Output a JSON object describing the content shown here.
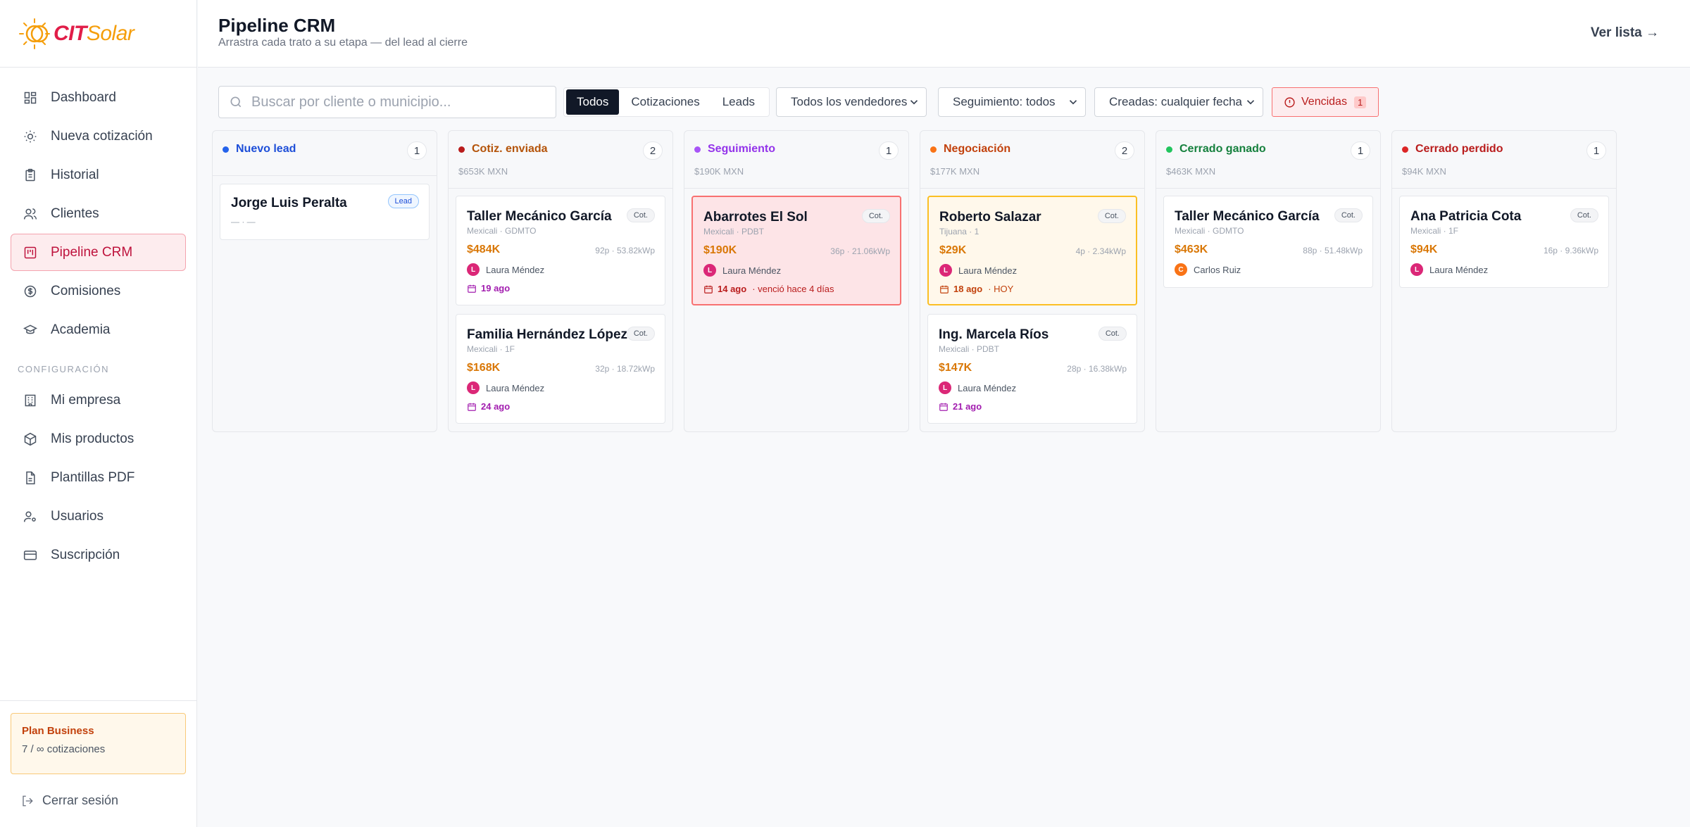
{
  "brand": {
    "cit": "CIT",
    "solar": "Solar"
  },
  "header": {
    "title": "Pipeline CRM",
    "subtitle": "Arrastra cada trato a su etapa — del lead al cierre",
    "ver_lista": "Ver lista →"
  },
  "sidebar": {
    "items": [
      {
        "label": "Dashboard",
        "icon": "dashboard-icon"
      },
      {
        "label": "Nueva cotización",
        "icon": "sun-icon"
      },
      {
        "label": "Historial",
        "icon": "clipboard-icon"
      },
      {
        "label": "Clientes",
        "icon": "users-icon"
      },
      {
        "label": "Pipeline CRM",
        "icon": "kanban-icon"
      },
      {
        "label": "Comisiones",
        "icon": "coin-icon"
      },
      {
        "label": "Academia",
        "icon": "graduation-cap-icon"
      }
    ],
    "section_label": "CONFIGURACIÓN",
    "config_items": [
      {
        "label": "Mi empresa",
        "icon": "building-icon"
      },
      {
        "label": "Mis productos",
        "icon": "box-icon"
      },
      {
        "label": "Plantillas PDF",
        "icon": "file-icon"
      },
      {
        "label": "Usuarios",
        "icon": "user-key-icon"
      },
      {
        "label": "Suscripción",
        "icon": "credit-card-icon"
      }
    ],
    "plan": {
      "title": "Plan Business",
      "usage": "7 / ∞ cotizaciones"
    },
    "logout": "Cerrar sesión"
  },
  "toolbar": {
    "search_placeholder": "Buscar por cliente o municipio...",
    "segments": [
      "Todos",
      "Cotizaciones",
      "Leads"
    ],
    "selected_segment": "Todos",
    "sellers": "Todos los vendedores",
    "followup": "Seguimiento: todos",
    "created": "Creadas: cualquier fecha",
    "overdue_label": "Vencidas",
    "overdue_count": "1"
  },
  "colors": {
    "accent": "#e11d48",
    "amount": "#d97706",
    "date": "#a21caf"
  },
  "columns": [
    {
      "title": "Nuevo lead",
      "color": "#2563eb",
      "count": "1",
      "total": "",
      "cards": [
        {
          "name": "Jorge Luis Peralta",
          "tag": "Lead",
          "sub": "— · —"
        }
      ]
    },
    {
      "title": "Cotiz. enviada",
      "color": "#b45309",
      "dot": "#b91c1c",
      "count": "2",
      "total": "$653K MXN",
      "cards": [
        {
          "name": "Taller Mecánico García",
          "tag": "Cot.",
          "loc": "Mexicali · GDMTO",
          "amount": "$484K",
          "spec": "92p · 53.82kWp",
          "seller": "Laura Méndez",
          "initial": "L",
          "avatar_color": "#db2777",
          "date": "19 ago",
          "extra": ""
        },
        {
          "name": "Familia Hernández López",
          "tag": "Cot.",
          "loc": "Mexicali · 1F",
          "amount": "$168K",
          "spec": "32p · 18.72kWp",
          "seller": "Laura Méndez",
          "initial": "L",
          "avatar_color": "#db2777",
          "date": "24 ago",
          "extra": ""
        }
      ]
    },
    {
      "title": "Seguimiento",
      "color": "#9333ea",
      "dot": "#a855f7",
      "count": "1",
      "total": "$190K MXN",
      "cards": [
        {
          "name": "Abarrotes El Sol",
          "tag": "Cot.",
          "loc": "Mexicali · PDBT",
          "amount": "$190K",
          "spec": "36p · 21.06kWp",
          "seller": "Laura Méndez",
          "initial": "L",
          "avatar_color": "#db2777",
          "date": "14 ago",
          "extra": "· venció hace 4 días",
          "state": "overdue"
        }
      ]
    },
    {
      "title": "Negociación",
      "color": "#c2410c",
      "dot": "#f97316",
      "count": "2",
      "total": "$177K MXN",
      "cards": [
        {
          "name": "Roberto Salazar",
          "tag": "Cot.",
          "loc": "Tijuana · 1",
          "amount": "$29K",
          "spec": "4p · 2.34kWp",
          "seller": "Laura Méndez",
          "initial": "L",
          "avatar_color": "#db2777",
          "date": "18 ago",
          "extra": "· HOY",
          "state": "today"
        },
        {
          "name": "Ing. Marcela Ríos",
          "tag": "Cot.",
          "loc": "Mexicali · PDBT",
          "amount": "$147K",
          "spec": "28p · 16.38kWp",
          "seller": "Laura Méndez",
          "initial": "L",
          "avatar_color": "#db2777",
          "date": "21 ago",
          "extra": ""
        }
      ]
    },
    {
      "title": "Cerrado ganado",
      "color": "#15803d",
      "dot": "#22c55e",
      "count": "1",
      "total": "$463K MXN",
      "cards": [
        {
          "name": "Taller Mecánico García",
          "tag": "Cot.",
          "loc": "Mexicali · GDMTO",
          "amount": "$463K",
          "spec": "88p · 51.48kWp",
          "seller": "Carlos Ruiz",
          "initial": "C",
          "avatar_color": "#f97316"
        }
      ]
    },
    {
      "title": "Cerrado perdido",
      "color": "#b91c1c",
      "dot": "#dc2626",
      "count": "1",
      "total": "$94K MXN",
      "cards": [
        {
          "name": "Ana Patricia Cota",
          "tag": "Cot.",
          "loc": "Mexicali · 1F",
          "amount": "$94K",
          "spec": "16p · 9.36kWp",
          "seller": "Laura Méndez",
          "initial": "L",
          "avatar_color": "#db2777"
        }
      ]
    }
  ]
}
